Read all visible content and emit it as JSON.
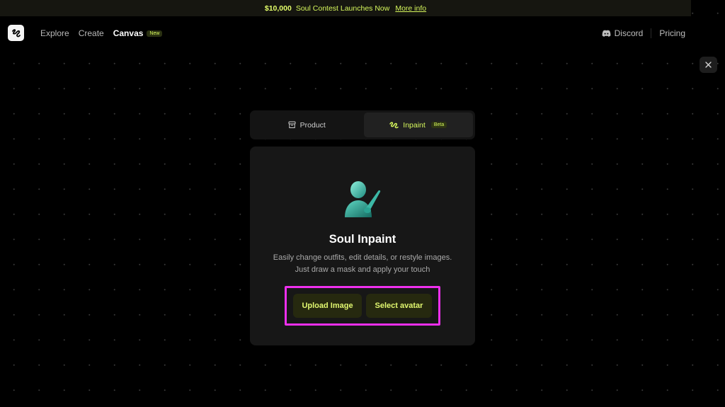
{
  "banner": {
    "amount": "$10,000",
    "text": "Soul Contest Launches Now",
    "link": "More info"
  },
  "nav": {
    "links": [
      {
        "label": "Explore"
      },
      {
        "label": "Create"
      },
      {
        "label": "Canvas",
        "badge": "New"
      }
    ],
    "discord": "Discord",
    "pricing": "Pricing"
  },
  "tabs": [
    {
      "label": "Product",
      "icon": "box-icon"
    },
    {
      "label": "Inpaint",
      "icon": "inpaint-logo-icon",
      "badge": "Beta",
      "active": true
    }
  ],
  "card": {
    "title": "Soul Inpaint",
    "desc_line1": "Easily change outfits, edit details, or restyle images.",
    "desc_line2": "Just draw a mask and apply your touch",
    "upload_label": "Upload Image",
    "avatar_label": "Select avatar"
  },
  "colors": {
    "accent": "#d6f75c",
    "highlight_frame": "#ee2fee",
    "background": "#000000"
  }
}
